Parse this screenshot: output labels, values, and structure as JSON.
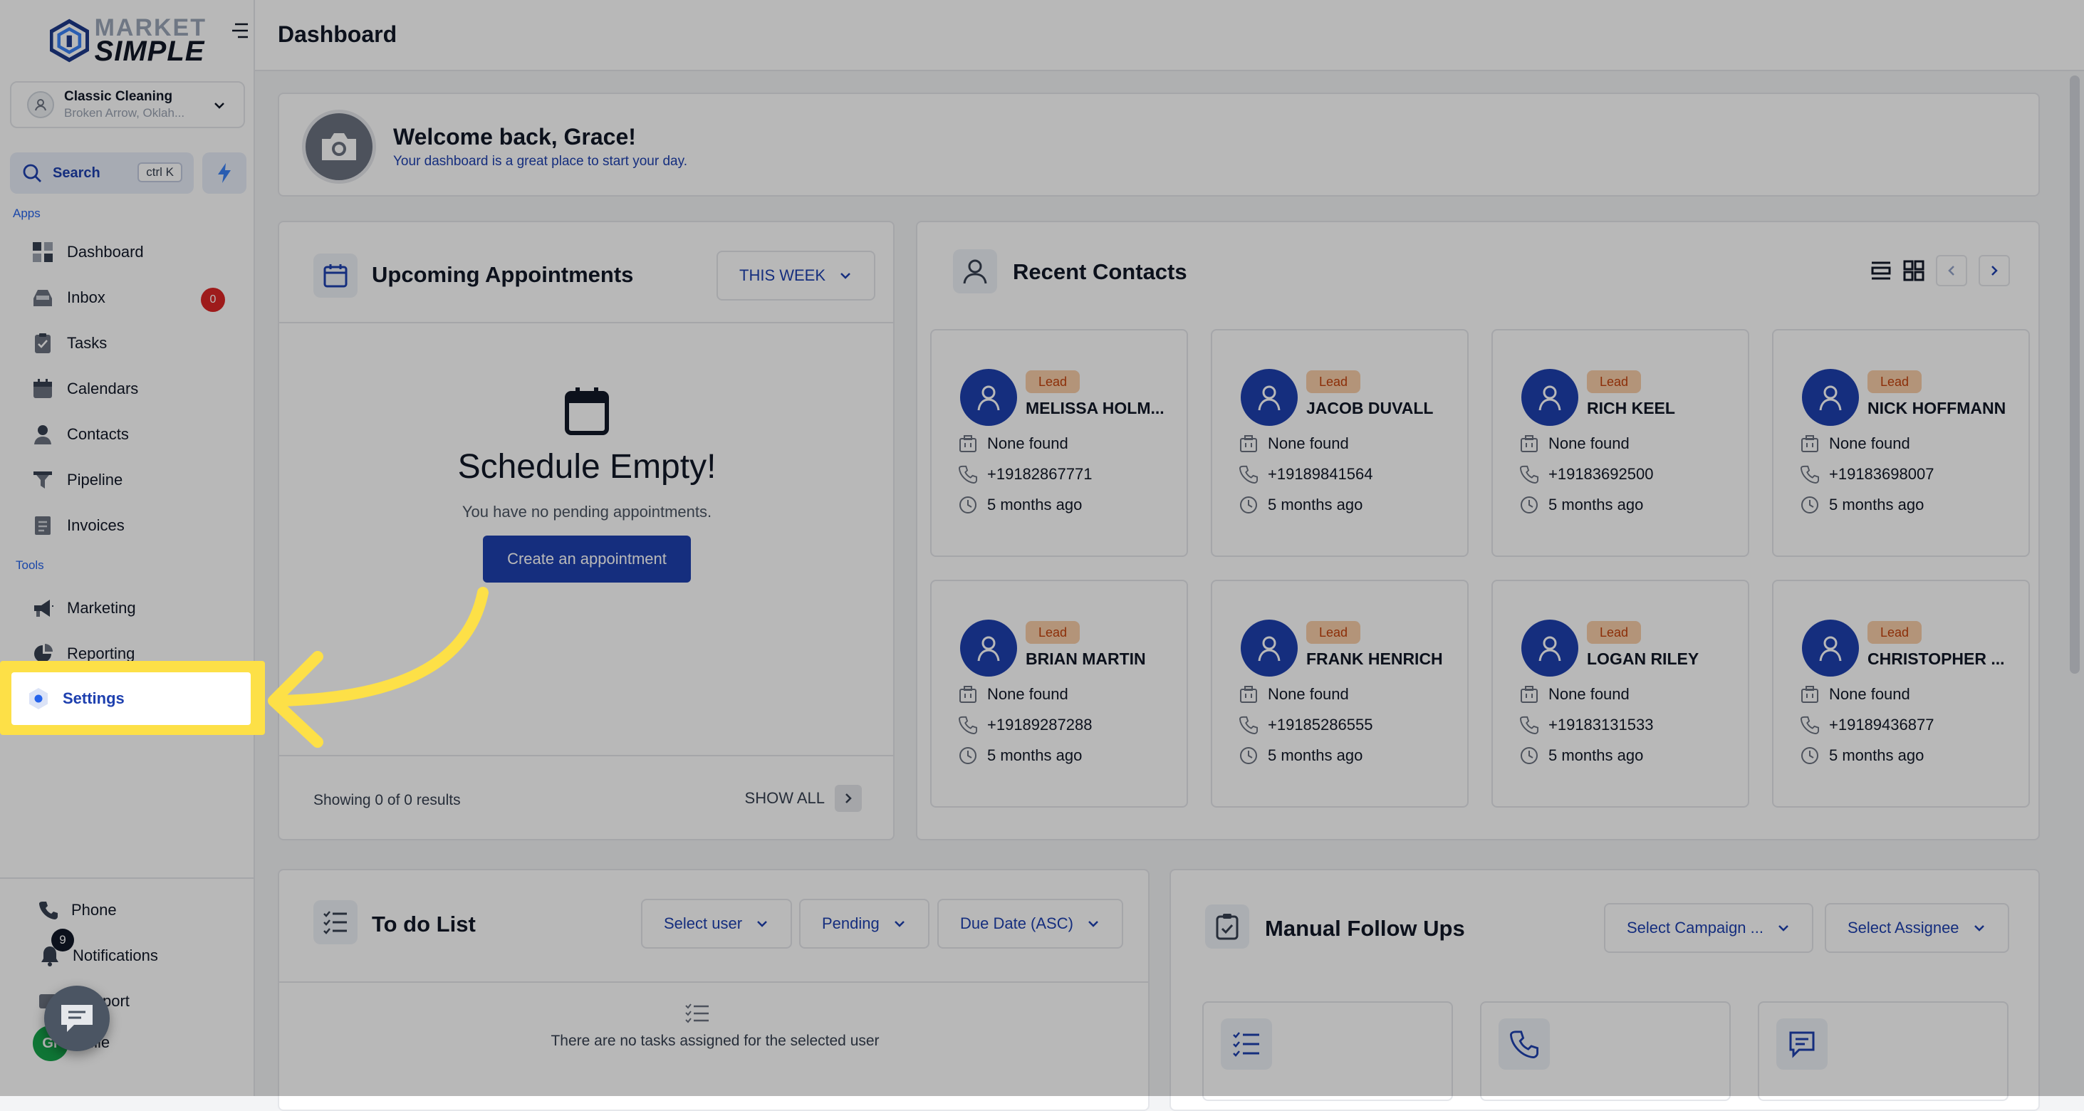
{
  "brand": {
    "line1": "MARKET",
    "line2": "SIMPLE"
  },
  "location": {
    "name": "Classic Cleaning",
    "address": "Broken Arrow, Oklah..."
  },
  "search": {
    "label": "Search",
    "shortcut": "ctrl K"
  },
  "sidebar": {
    "apps_label": "Apps",
    "tools_label": "Tools",
    "apps": [
      {
        "label": "Dashboard",
        "icon": "dashboard-icon"
      },
      {
        "label": "Inbox",
        "icon": "inbox-icon",
        "badge": "0"
      },
      {
        "label": "Tasks",
        "icon": "tasks-icon"
      },
      {
        "label": "Calendars",
        "icon": "calendar-icon"
      },
      {
        "label": "Contacts",
        "icon": "contacts-icon"
      },
      {
        "label": "Pipeline",
        "icon": "pipeline-icon"
      },
      {
        "label": "Invoices",
        "icon": "invoices-icon"
      }
    ],
    "tools": [
      {
        "label": "Marketing",
        "icon": "megaphone-icon"
      },
      {
        "label": "Reporting",
        "icon": "reporting-icon"
      },
      {
        "label": "Settings",
        "icon": "settings-icon"
      }
    ],
    "bottom": {
      "phone": "Phone",
      "notifications": "Notifications",
      "notifications_badge": "9",
      "support": "port",
      "profile": "file",
      "profile_initials": "Gr"
    }
  },
  "header": {
    "title": "Dashboard"
  },
  "welcome": {
    "title": "Welcome back, Grace!",
    "subtitle": "Your dashboard is a great place to start your day."
  },
  "appointments": {
    "title": "Upcoming Appointments",
    "filter": "THIS WEEK",
    "empty_title": "Schedule Empty!",
    "empty_sub": "You have no pending appointments.",
    "create_button": "Create an appointment",
    "showing": "Showing 0 of 0 results",
    "show_all": "SHOW ALL"
  },
  "recent_contacts": {
    "title": "Recent Contacts",
    "contacts": [
      {
        "name": "MELISSA HOLM...",
        "badge": "Lead",
        "company": "None found",
        "phone": "+19182867771",
        "time": "5 months ago"
      },
      {
        "name": "JACOB DUVALL",
        "badge": "Lead",
        "company": "None found",
        "phone": "+19189841564",
        "time": "5 months ago"
      },
      {
        "name": "RICH KEEL",
        "badge": "Lead",
        "company": "None found",
        "phone": "+19183692500",
        "time": "5 months ago"
      },
      {
        "name": "NICK HOFFMANN",
        "badge": "Lead",
        "company": "None found",
        "phone": "+19183698007",
        "time": "5 months ago"
      },
      {
        "name": "BRIAN MARTIN",
        "badge": "Lead",
        "company": "None found",
        "phone": "+19189287288",
        "time": "5 months ago"
      },
      {
        "name": "FRANK HENRICH",
        "badge": "Lead",
        "company": "None found",
        "phone": "+19185286555",
        "time": "5 months ago"
      },
      {
        "name": "LOGAN RILEY",
        "badge": "Lead",
        "company": "None found",
        "phone": "+19183131533",
        "time": "5 months ago"
      },
      {
        "name": "CHRISTOPHER ...",
        "badge": "Lead",
        "company": "None found",
        "phone": "+19189436877",
        "time": "5 months ago"
      }
    ]
  },
  "todo": {
    "title": "To do List",
    "select_user": "Select user",
    "status": "Pending",
    "sort": "Due Date (ASC)",
    "empty": "There are no tasks assigned for the selected user"
  },
  "followups": {
    "title": "Manual Follow Ups",
    "select_campaign": "Select Campaign ...",
    "select_assignee": "Select Assignee"
  },
  "colors": {
    "accent": "#1e40af",
    "highlight": "#fde047",
    "lead_badge": "#f9cda8",
    "inbox_badge": "#dc2626"
  }
}
